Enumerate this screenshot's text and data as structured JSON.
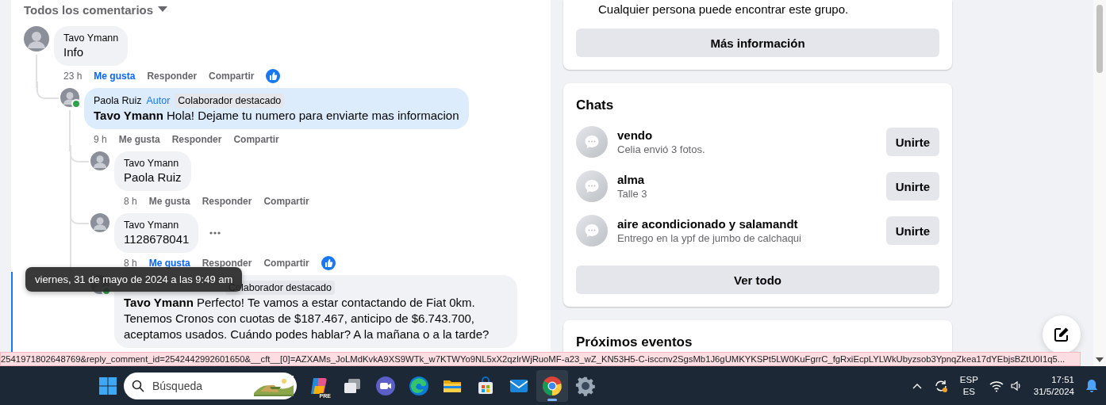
{
  "comments_header": {
    "label": "Todos los comentarios",
    "dropdown": true
  },
  "comments": [
    {
      "author": "Tavo Ymann",
      "online": false,
      "text": "Info",
      "highlighted": false,
      "focused": false,
      "actions": {
        "time": "23 h",
        "time_hovered": false,
        "like": "Me gusta",
        "liked": true,
        "reply": "Responder",
        "share": "Compartir"
      },
      "more": false,
      "children": [
        {
          "author": "Paola Ruiz",
          "online": true,
          "badges": [
            {
              "label": "Autor",
              "kind": "author"
            },
            {
              "label": "Colaborador destacado",
              "kind": "top"
            }
          ],
          "mention": "Tavo Ymann",
          "text": "Hola! Dejame tu numero para enviarte mas informacion",
          "highlighted": true,
          "focused": false,
          "actions": {
            "time": "9 h",
            "time_hovered": false,
            "like": "Me gusta",
            "liked": false,
            "reply": "Responder",
            "share": "Compartir"
          },
          "more": false,
          "children": [
            {
              "author": "Tavo Ymann",
              "online": false,
              "text": "Paola Ruiz",
              "highlighted": false,
              "focused": false,
              "actions": {
                "time": "8 h",
                "time_hovered": false,
                "like": "Me gusta",
                "liked": false,
                "reply": "Responder",
                "share": "Compartir"
              },
              "more": false
            },
            {
              "author": "Tavo Ymann",
              "online": false,
              "text": "1128678041",
              "highlighted": false,
              "focused": false,
              "actions": {
                "time": "8 h",
                "time_hovered": true,
                "like": "Me gusta",
                "liked": true,
                "reply": "Responder",
                "share": "Compartir"
              },
              "more": true
            },
            {
              "online": true,
              "badges": [
                {
                  "label": "Colaborador destacado",
                  "kind": "top"
                }
              ],
              "mention": "Tavo Ymann",
              "text": "Perfecto! Te vamos a estar contactando de Fiat 0km. Tenemos Cronos con cuotas de $187.467, anticipo de $6.743.700, aceptamos usados. Cuándo podes hablar? A la mañana o a la tarde?",
              "highlighted": false,
              "focused": true,
              "more": false
            }
          ]
        }
      ]
    }
  ],
  "tooltip": "viernes, 31 de mayo de 2024 a las 9:49 am",
  "about_card": {
    "text": "Cualquier persona puede encontrar este grupo.",
    "button": "Más información"
  },
  "chats_card": {
    "title": "Chats",
    "chats": [
      {
        "name": "vendo",
        "last_message": "Celia envió 3 fotos.",
        "button": "Unirte"
      },
      {
        "name": "alma",
        "last_message": "Talle 3",
        "button": "Unirte"
      },
      {
        "name": "aire acondicionado y salamandt",
        "last_message": "Entrego en la ypf de jumbo de calchaqui",
        "button": "Unirte"
      }
    ],
    "see_all": "Ver todo"
  },
  "events_card": {
    "title": "Próximos eventos"
  },
  "status_url": "2541971802648769&reply_comment_id=2542442992601650&__cft__[0]=AZXAMs_JoLMdKvkA9XS9WTk_w7KTWYo9NL5xX2qzlrWjRuoMF-a23_wZ_KN53H5-C-isccnv2SgsMb1J6gUMKYKSPt5LW0KuFgrrC_fgRxiEcpLYLWkUbyzsob3YpnqZkea17dYEbjsBZtU0I1q5...",
  "taskbar": {
    "search_placeholder": "Búsqueda",
    "apps": [
      {
        "kind": "copilot",
        "badge": "PRE",
        "active": false
      },
      {
        "kind": "taskview",
        "active": false
      },
      {
        "kind": "meet",
        "active": false
      },
      {
        "kind": "edge",
        "active": false
      },
      {
        "kind": "folder",
        "active": false
      },
      {
        "kind": "store",
        "active": false
      },
      {
        "kind": "mail",
        "active": false
      },
      {
        "kind": "chrome",
        "active": true
      },
      {
        "kind": "settings",
        "active": false
      }
    ],
    "language": "ESP",
    "layout": "ES",
    "time": "17:51",
    "date": "31/5/2024"
  }
}
